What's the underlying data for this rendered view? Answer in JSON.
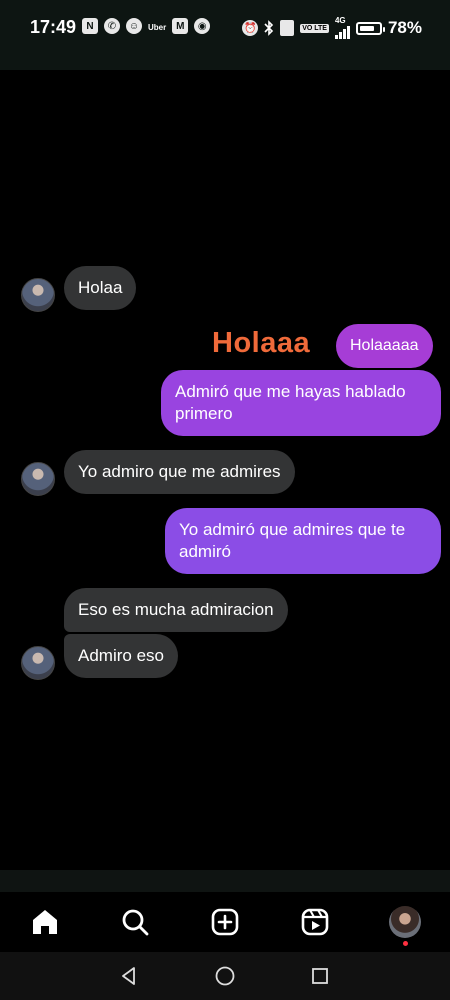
{
  "status_bar": {
    "time": "17:49",
    "left_icons": [
      "nfc-icon",
      "whatsapp-icon",
      "ghost-icon",
      "uber-icon",
      "gmail-icon",
      "chrome-icon"
    ],
    "uber_text": "Uber",
    "right_icons": [
      "alarm-icon",
      "bluetooth-icon",
      "vibrate-icon",
      "volte-icon",
      "signal-icon",
      "battery-icon"
    ],
    "volte_text": "VO LTE",
    "network": "4G",
    "battery_level": 0.78,
    "battery_text": "78%"
  },
  "chat": {
    "messages": [
      {
        "side": "in",
        "text": "Holaa"
      },
      {
        "side": "out",
        "text": "Holaaaaa"
      },
      {
        "side": "out",
        "text": "Admiró que me hayas hablado primero"
      },
      {
        "side": "in",
        "text": "Yo admiro que me admires"
      },
      {
        "side": "out",
        "text": "Yo admiró que admires que te admiró"
      },
      {
        "side": "in",
        "text": "Eso es mucha admiracion"
      },
      {
        "side": "in",
        "text": "Admiro eso"
      }
    ],
    "sticker_text": "Holaaa"
  },
  "colors": {
    "incoming_bubble": "#333435",
    "outgoing_top": "#a63dd6",
    "outgoing_bottom": "#8b4de6",
    "sticker": "#f06a3a",
    "notification_dot": "#ff3040"
  },
  "bottom_nav": [
    "home-icon",
    "search-icon",
    "create-icon",
    "reels-icon",
    "profile-avatar"
  ],
  "system_nav": [
    "back-icon",
    "home-circle-icon",
    "recents-icon"
  ]
}
